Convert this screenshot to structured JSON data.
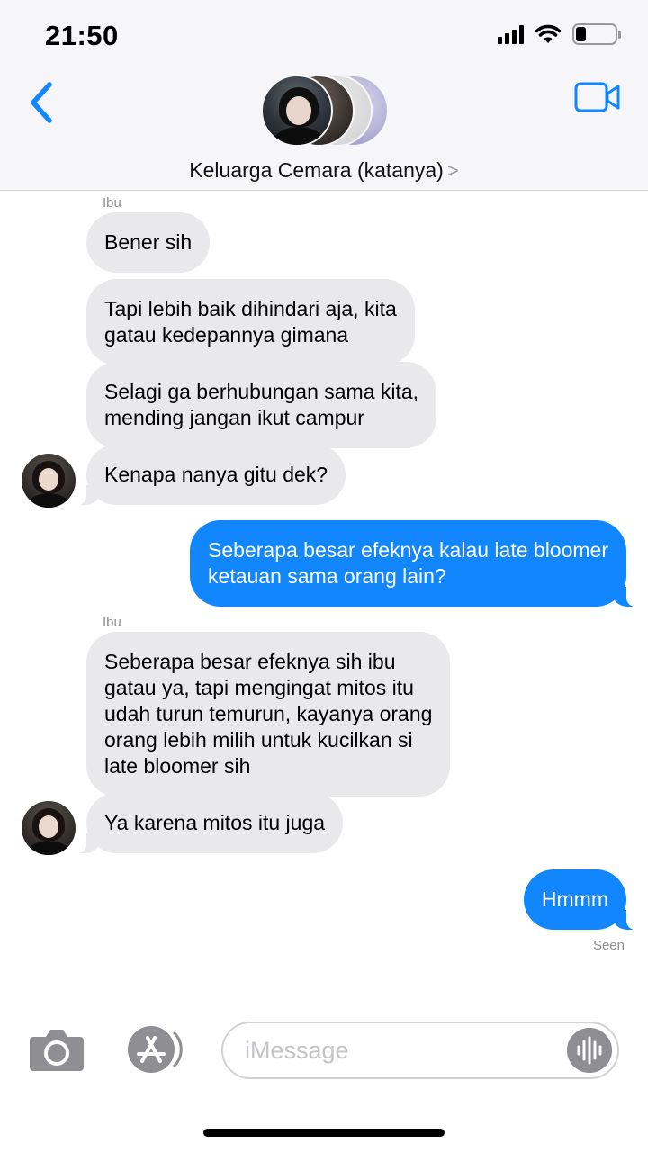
{
  "status_bar": {
    "time": "21:50",
    "battery_level": 0.25
  },
  "header": {
    "group_name": "Keluarga Cemara (katanya)",
    "chevron": ">"
  },
  "messages": [
    {
      "sender_label": "Ibu",
      "text_lines": [
        "Bener sih"
      ]
    },
    {
      "text_lines": [
        "Tapi lebih baik dihindari aja, kita",
        "gatau kedepannya gimana"
      ]
    },
    {
      "text_lines": [
        "Selagi ga berhubungan sama kita,",
        "mending jangan ikut campur"
      ]
    },
    {
      "text_lines": [
        "Kenapa nanya gitu dek?"
      ]
    },
    {
      "direction": "outgoing",
      "text_lines": [
        "Seberapa besar efeknya kalau late bloomer",
        "ketauan sama orang lain?"
      ]
    },
    {
      "sender_label": "Ibu",
      "text_lines": [
        "Seberapa besar efeknya sih ibu",
        "gatau ya, tapi mengingat mitos itu",
        "udah turun temurun, kayanya orang",
        "orang lebih milih untuk kucilkan si",
        "late bloomer sih"
      ]
    },
    {
      "text_lines": [
        "Ya karena mitos itu juga"
      ]
    },
    {
      "direction": "outgoing",
      "text_lines": [
        "Hmmm"
      ]
    }
  ],
  "read_receipt": "Seen",
  "compose": {
    "placeholder": "iMessage"
  },
  "icons": [
    "back-chevron-icon",
    "video-camera-icon",
    "camera-icon",
    "app-store-icon",
    "audio-waveform-icon"
  ],
  "colors": {
    "accent": "#1186fd",
    "incoming_bubble": "#e9e9eb",
    "outgoing_bubble": "#1186fd"
  }
}
